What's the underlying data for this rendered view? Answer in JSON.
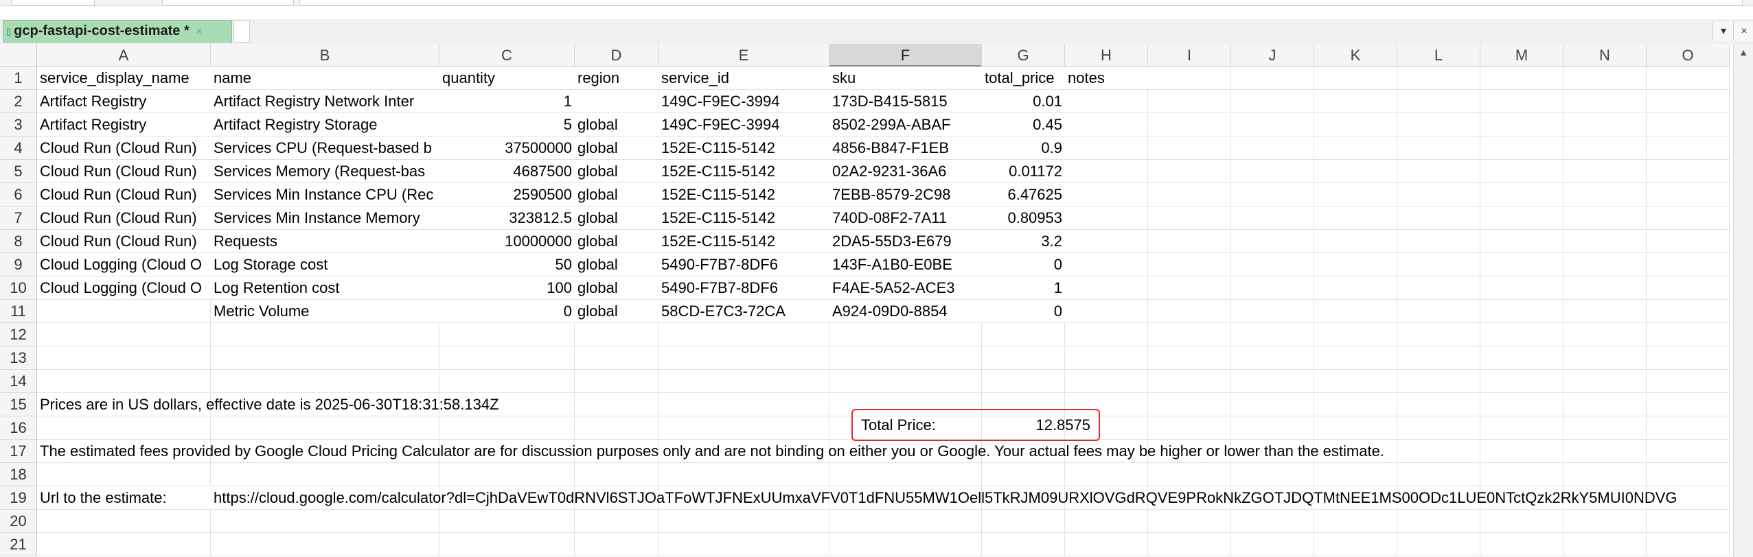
{
  "tabbar": {
    "tab_label": "gcp-fastapi-cost-estimate *",
    "tab_close": "×",
    "menu_btn": "▾",
    "close_btn": "×"
  },
  "columns": [
    "A",
    "B",
    "C",
    "D",
    "E",
    "F",
    "G",
    "H",
    "I",
    "J",
    "K",
    "L",
    "M",
    "N",
    "O"
  ],
  "selected_column": "F",
  "rows": [
    "1",
    "2",
    "3",
    "4",
    "5",
    "6",
    "7",
    "8",
    "9",
    "10",
    "11",
    "12",
    "13",
    "14",
    "15",
    "16",
    "17",
    "18",
    "19",
    "20",
    "21"
  ],
  "table": {
    "header": [
      "service_display_name",
      "name",
      "quantity",
      "region",
      "service_id",
      "sku",
      "total_price",
      "notes"
    ],
    "data": [
      [
        "Artifact Registry",
        "Artifact Registry Network Inter",
        "1",
        "",
        "149C-F9EC-3994",
        "173D-B415-5815",
        "0.01"
      ],
      [
        "Artifact Registry",
        "Artifact Registry Storage",
        "5",
        "global",
        "149C-F9EC-3994",
        "8502-299A-ABAF",
        "0.45"
      ],
      [
        "Cloud Run  (Cloud Run)",
        "Services CPU (Request-based b",
        "37500000",
        "global",
        "152E-C115-5142",
        "4856-B847-F1EB",
        "0.9"
      ],
      [
        "Cloud Run  (Cloud Run)",
        "Services Memory (Request-bas",
        "4687500",
        "global",
        "152E-C115-5142",
        "02A2-9231-36A6",
        "0.01172"
      ],
      [
        "Cloud Run  (Cloud Run)",
        "Services Min Instance CPU (Rec",
        "2590500",
        "global",
        "152E-C115-5142",
        "7EBB-8579-2C98",
        "6.47625"
      ],
      [
        "Cloud Run  (Cloud Run)",
        "Services Min Instance Memory",
        "323812.5",
        "global",
        "152E-C115-5142",
        "740D-08F2-7A11",
        "0.80953"
      ],
      [
        "Cloud Run  (Cloud Run)",
        "Requests",
        "10000000",
        "global",
        "152E-C115-5142",
        "2DA5-55D3-E679",
        "3.2"
      ],
      [
        "Cloud Logging (Cloud O",
        "Log Storage cost",
        "50",
        "global",
        "5490-F7B7-8DF6",
        "143F-A1B0-E0BE",
        "0"
      ],
      [
        "Cloud Logging (Cloud O",
        "Log Retention cost",
        "100",
        "global",
        "5490-F7B7-8DF6",
        "F4AE-5A52-ACE3",
        "1"
      ],
      [
        "",
        "Metric Volume",
        "0",
        "global",
        "58CD-E7C3-72CA",
        "A924-09D0-8854",
        "0"
      ]
    ]
  },
  "total": {
    "label": "Total Price:",
    "value": "12.8575"
  },
  "notes": {
    "prices_line": "Prices are in US dollars, effective date is 2025-06-30T18:31:58.134Z",
    "disclaimer": "The estimated fees provided by Google Cloud Pricing Calculator are for discussion purposes only and are not binding on either you or Google. Your actual fees may be higher or lower than the estimate.",
    "url_label": "Url to the estimate:",
    "url_value": "https://cloud.google.com/calculator?dl=CjhDaVEwT0dRNVl6STJOaTFoWTJFNExUUmxaVFV0T1dFNU55MW1Oell5TkRJM09URXlOVGdRQVE9PRokNkZGOTJDQTMtNEE1MS00ODc1LUE0NTctQzk2RkY5MUI0NDVG"
  }
}
